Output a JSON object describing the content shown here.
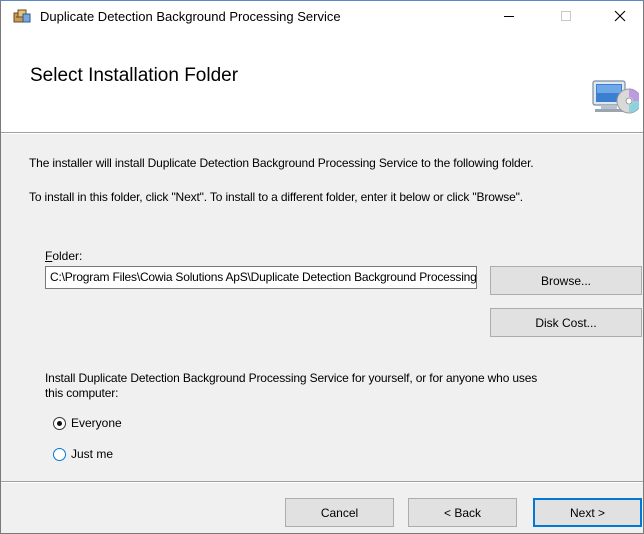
{
  "window": {
    "title": "Duplicate Detection Background Processing Service",
    "minimize_icon": "minimize-icon",
    "maximize_icon": "maximize-icon",
    "close_icon": "close-icon"
  },
  "header": {
    "heading": "Select Installation Folder",
    "icon": "computer-disc-icon"
  },
  "body": {
    "line1": "The installer will install Duplicate Detection Background Processing Service to the following folder.",
    "line2": "To install in this folder, click \"Next\". To install to a different folder, enter it below or click \"Browse\".",
    "folder_label_accel": "F",
    "folder_label_rest": "older:",
    "folder_value": "C:\\Program Files\\Cowia Solutions ApS\\Duplicate Detection Background Processing Service\\",
    "browse_label": "Browse...",
    "disk_cost_label": "Disk Cost...",
    "install_for_line1": "Install Duplicate Detection Background Processing Service for yourself, or for anyone who uses",
    "install_for_line2": "this computer:",
    "options": [
      {
        "label": "Everyone",
        "selected": true
      },
      {
        "label": "Just me",
        "selected": false
      }
    ]
  },
  "footer": {
    "cancel_label": "Cancel",
    "back_label": "< Back",
    "next_label": "Next >"
  }
}
